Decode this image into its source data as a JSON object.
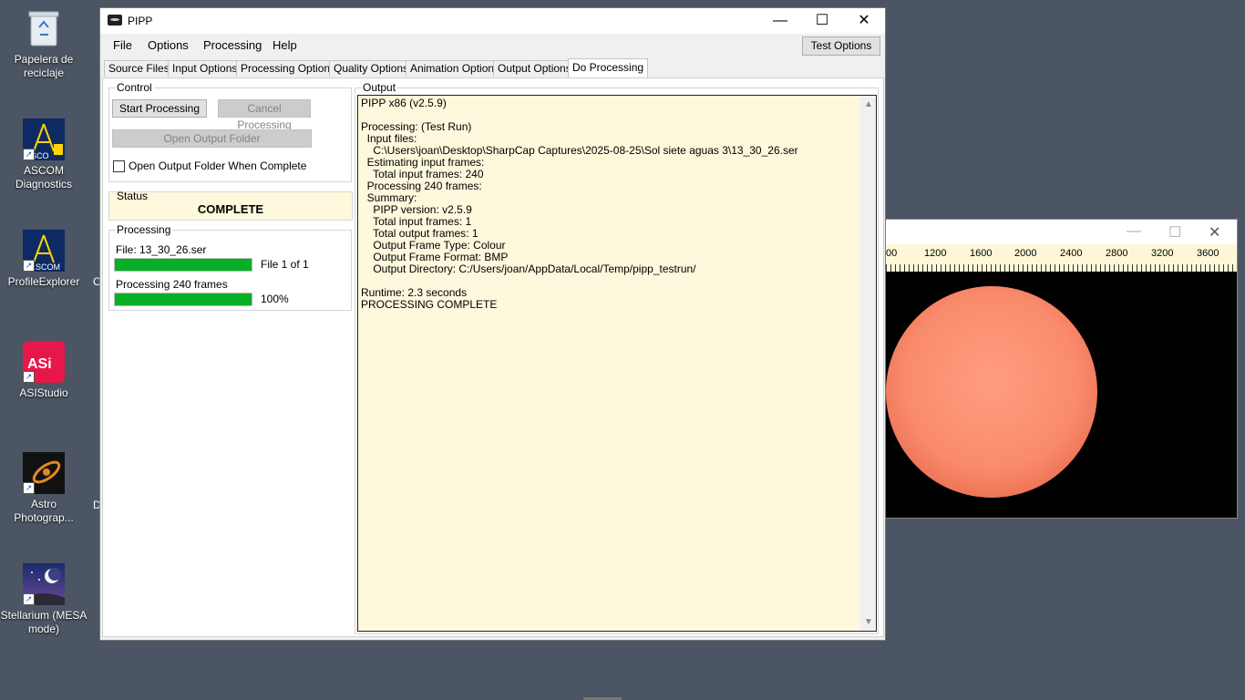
{
  "desktop": {
    "icons": [
      {
        "label": "Papelera de reciclaje",
        "icon": "recycle-bin-icon"
      },
      {
        "label": "ASCOM Diagnostics",
        "icon": "ascom-icon"
      },
      {
        "label": "ProfileExplorer",
        "icon": "ascom-icon"
      },
      {
        "label": "ASIStudio",
        "icon": "asi-icon"
      },
      {
        "label": "Astro Photograp...",
        "icon": "astro-photography-icon"
      },
      {
        "label": "Stellarium (MESA mode)",
        "icon": "stellarium-icon"
      }
    ],
    "partial_letters": [
      "C",
      "D"
    ]
  },
  "viewer": {
    "ruler_ticks": [
      "00",
      "1200",
      "1600",
      "2000",
      "2400",
      "2800",
      "3200",
      "3600"
    ]
  },
  "window": {
    "title": "PIPP",
    "menu": [
      "File",
      "Options",
      "Processing",
      "Help"
    ],
    "test_options": "Test Options",
    "tabs": [
      "Source Files",
      "Input Options",
      "Processing Options",
      "Quality Options",
      "Animation Options",
      "Output Options",
      "Do Processing"
    ],
    "active_tab": "Do Processing"
  },
  "control": {
    "legend": "Control",
    "start": "Start Processing",
    "cancel": "Cancel Processing",
    "open_folder": "Open Output Folder",
    "open_when_complete": "Open Output Folder When Complete",
    "open_when_complete_checked": false
  },
  "status": {
    "legend": "Status",
    "value": "COMPLETE"
  },
  "processing": {
    "legend": "Processing",
    "file_label": "File: 13_30_26.ser",
    "file_progress": 1.0,
    "file_progress_text": "File 1 of 1",
    "frames_label": "Processing 240 frames",
    "frames_progress": 1.0,
    "frames_progress_text": "100%"
  },
  "output": {
    "legend": "Output",
    "text": "PIPP x86 (v2.5.9)\n\nProcessing: (Test Run)\n  Input files:\n    C:\\Users\\joan\\Desktop\\SharpCap Captures\\2025-08-25\\Sol siete aguas 3\\13_30_26.ser\n  Estimating input frames:\n    Total input frames: 240\n  Processing 240 frames:\n  Summary:\n    PIPP version: v2.5.9\n    Total input frames: 1\n    Total output frames: 1\n    Output Frame Type: Colour\n    Output Frame Format: BMP\n    Output Directory: C:/Users/joan/AppData/Local/Temp/pipp_testrun/\n\nRuntime: 2.3 seconds\nPROCESSING COMPLETE"
  },
  "colors": {
    "progress": "#06b025",
    "output_bg": "#fef8dc",
    "desktop": "#4b5563"
  }
}
